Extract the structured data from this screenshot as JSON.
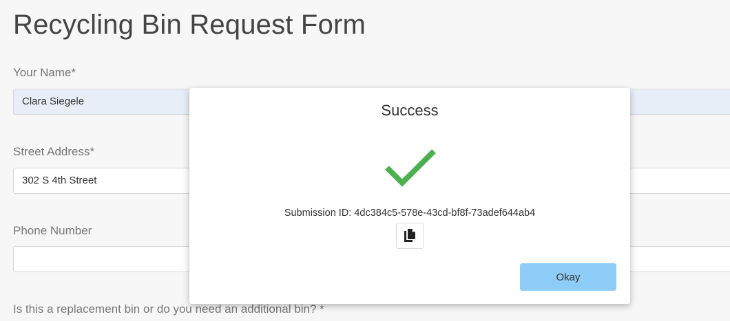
{
  "page": {
    "title": "Recycling Bin Request Form"
  },
  "form": {
    "name_label": "Your Name*",
    "name_value": "Clara Siegele",
    "address_label": "Street Address*",
    "address_value": "302 S 4th Street",
    "phone_label": "Phone Number",
    "phone_value": "",
    "bin_question_label": "Is this a replacement bin or do you need an additional bin? *"
  },
  "modal": {
    "title": "Success",
    "icon": "checkmark-icon",
    "submission_prefix": "Submission ID: ",
    "submission_id": "4dc384c5-578e-43cd-bf8f-73adef644ab4",
    "copy_icon": "copy-icon",
    "okay_label": "Okay"
  },
  "colors": {
    "check": "#4caf50",
    "okay_button": "#8ecdf8",
    "filled_input": "#e8eef8"
  }
}
